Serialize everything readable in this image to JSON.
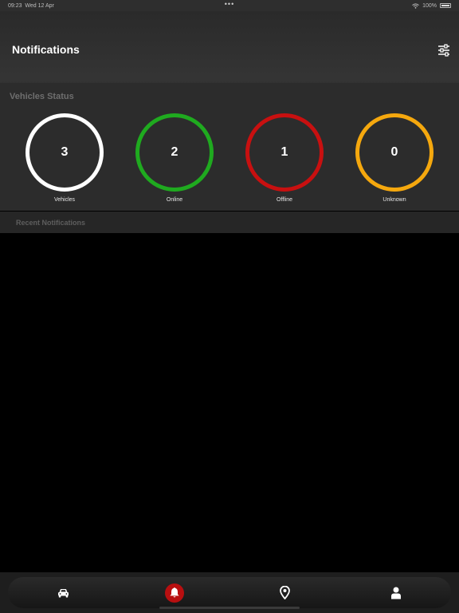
{
  "status_bar": {
    "time": "09:23",
    "date": "Wed 12 Apr",
    "dots": "•••",
    "battery": "100%"
  },
  "header": {
    "title": "Notifications",
    "filter_icon": "sliders-icon"
  },
  "vehicles_status": {
    "title": "Vehicles Status",
    "stats": [
      {
        "value": "3",
        "label": "Vehicles",
        "color": "#ffffff"
      },
      {
        "value": "2",
        "label": "Online",
        "color": "#1faa1f"
      },
      {
        "value": "1",
        "label": "Offline",
        "color": "#c81010"
      },
      {
        "value": "0",
        "label": "Unknown",
        "color": "#f5a80e"
      }
    ]
  },
  "recent_notifications": {
    "title": "Recent Notifications"
  },
  "tab_bar": {
    "tabs": [
      {
        "icon": "car-icon",
        "active": false
      },
      {
        "icon": "bell-icon",
        "active": true
      },
      {
        "icon": "map-pin-icon",
        "active": false
      },
      {
        "icon": "person-icon",
        "active": false
      }
    ],
    "accent": "#b80f10"
  }
}
